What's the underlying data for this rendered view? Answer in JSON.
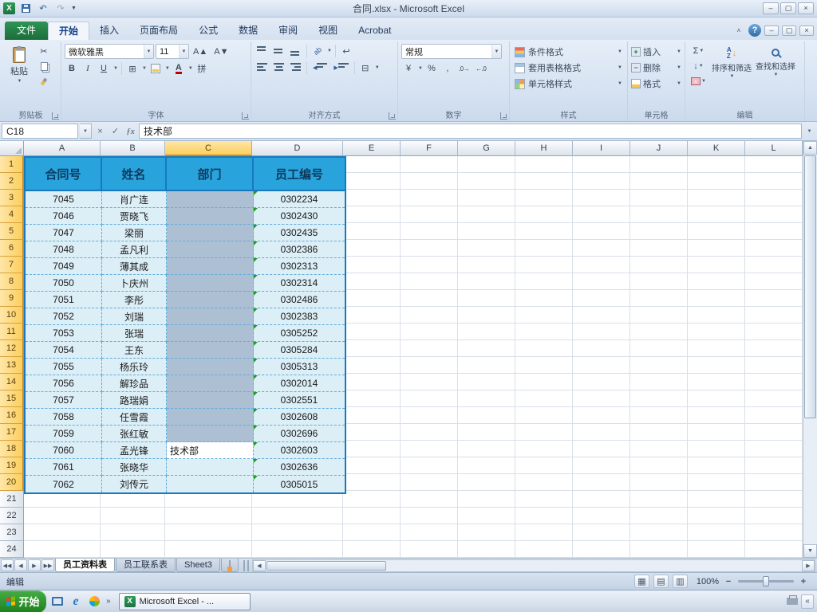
{
  "window": {
    "title": "合同.xlsx - Microsoft Excel"
  },
  "ribbon": {
    "tabs": [
      {
        "label": "文件",
        "active": false
      },
      {
        "label": "开始",
        "active": true
      },
      {
        "label": "插入",
        "active": false
      },
      {
        "label": "页面布局",
        "active": false
      },
      {
        "label": "公式",
        "active": false
      },
      {
        "label": "数据",
        "active": false
      },
      {
        "label": "审阅",
        "active": false
      },
      {
        "label": "视图",
        "active": false
      },
      {
        "label": "Acrobat",
        "active": false
      }
    ],
    "clipboard": {
      "paste": "粘贴",
      "label": "剪贴板"
    },
    "font": {
      "name": "微软雅黑",
      "size": "11",
      "label": "字体"
    },
    "alignment": {
      "label": "对齐方式"
    },
    "number": {
      "format": "常规",
      "label": "数字"
    },
    "styles": {
      "conditional": "条件格式",
      "table_format": "套用表格格式",
      "cell_styles": "单元格样式",
      "label": "样式"
    },
    "cells": {
      "insert": "插入",
      "delete": "删除",
      "format": "格式",
      "label": "单元格"
    },
    "editing": {
      "sort": "排序和筛选",
      "find": "查找和选择",
      "label": "编辑"
    }
  },
  "formula_bar": {
    "name_box": "C18",
    "content": "技术部"
  },
  "grid": {
    "columns": [
      "A",
      "B",
      "C",
      "D",
      "E",
      "F",
      "G",
      "H",
      "I",
      "J",
      "K",
      "L"
    ],
    "selection": {
      "selected_cells": "C3:C17",
      "active_cell": "C18"
    },
    "table": {
      "headers": [
        "合同号",
        "姓名",
        "部门",
        "员工编号"
      ],
      "rows": [
        {
          "contract": "7045",
          "name": "肖广连",
          "dept": "",
          "id": "0302234"
        },
        {
          "contract": "7046",
          "name": "贾晓飞",
          "dept": "",
          "id": "0302430"
        },
        {
          "contract": "7047",
          "name": "梁丽",
          "dept": "",
          "id": "0302435"
        },
        {
          "contract": "7048",
          "name": "孟凡利",
          "dept": "",
          "id": "0302386"
        },
        {
          "contract": "7049",
          "name": "薄其成",
          "dept": "",
          "id": "0302313"
        },
        {
          "contract": "7050",
          "name": "卜庆州",
          "dept": "",
          "id": "0302314"
        },
        {
          "contract": "7051",
          "name": "李彤",
          "dept": "",
          "id": "0302486"
        },
        {
          "contract": "7052",
          "name": "刘瑞",
          "dept": "",
          "id": "0302383"
        },
        {
          "contract": "7053",
          "name": "张瑞",
          "dept": "",
          "id": "0305252"
        },
        {
          "contract": "7054",
          "name": "王东",
          "dept": "",
          "id": "0305284"
        },
        {
          "contract": "7055",
          "name": "杨乐玲",
          "dept": "",
          "id": "0305313"
        },
        {
          "contract": "7056",
          "name": "解珍品",
          "dept": "",
          "id": "0302014"
        },
        {
          "contract": "7057",
          "name": "路瑞娟",
          "dept": "",
          "id": "0302551"
        },
        {
          "contract": "7058",
          "name": "任雪霞",
          "dept": "",
          "id": "0302608"
        },
        {
          "contract": "7059",
          "name": "张红敏",
          "dept": "",
          "id": "0302696"
        },
        {
          "contract": "7060",
          "name": "孟光锋",
          "dept": "技术部",
          "id": "0302603"
        },
        {
          "contract": "7061",
          "name": "张晓华",
          "dept": "",
          "id": "0302636"
        },
        {
          "contract": "7062",
          "name": "刘传元",
          "dept": "",
          "id": "0305015"
        }
      ]
    }
  },
  "sheet_tabs": {
    "tabs": [
      {
        "label": "员工资料表",
        "active": true
      },
      {
        "label": "员工联系表",
        "active": false
      },
      {
        "label": "Sheet3",
        "active": false
      }
    ]
  },
  "status_bar": {
    "mode": "编辑",
    "zoom": "100%"
  },
  "taskbar": {
    "start_label": "开始",
    "task_label": "Microsoft Excel - ..."
  },
  "icons": {
    "undo": "↶",
    "redo": "↷",
    "minimize": "–",
    "restore": "▢",
    "close": "×",
    "ribbon_collapse": "˄",
    "help": "?",
    "dropdown": "▼",
    "cut": "✂",
    "bold": "B",
    "italic": "I",
    "underline": "U",
    "borders": "⊞",
    "wrap_text": "↩",
    "merge_center": "⊟",
    "orientation": "ab",
    "currency": "¥",
    "percent": "%",
    "comma": ",",
    "increase_decimal": ".0→",
    "decrease_decimal": "←.0",
    "sigma": "Σ",
    "fill_down": "↓",
    "clear": "×",
    "fx": "ƒx",
    "enter": "✓",
    "cancel": "×",
    "sort_a": "A",
    "sort_z": "Z",
    "sort_arrow": "↓",
    "pinyin": "拼",
    "font_up": "A▲",
    "font_down": "A▼",
    "nav_first": "◀◀",
    "nav_prev": "◀",
    "nav_next": "▶",
    "nav_last": "▶▶",
    "scroll_up": "▲",
    "scroll_down": "▼",
    "scroll_left": "◀",
    "scroll_right": "▶",
    "view_normal": "▦",
    "view_page_layout": "▤",
    "view_page_break": "▥",
    "zoom_out": "−",
    "zoom_in": "+",
    "overflow": "»",
    "tray_collapse": "«",
    "insert_cell_plus": "+",
    "delete_cell_minus": "−",
    "ie": "e"
  }
}
